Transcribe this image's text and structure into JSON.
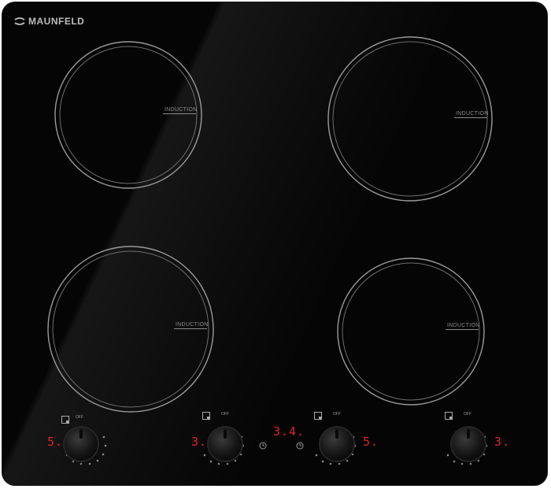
{
  "brand": {
    "name": "MAUNFELD"
  },
  "zones": [
    {
      "label": "INDUCTION"
    },
    {
      "label": "INDUCTION"
    },
    {
      "label": "INDUCTION"
    },
    {
      "label": "INDUCTION"
    }
  ],
  "controls": {
    "zone1_power": "5.",
    "zone2_power": "3.",
    "timer_display": "3.4.",
    "zone3_power": "5.",
    "zone4_power": "3.",
    "knob_off_label": "OFF"
  },
  "colors": {
    "glass": "#050505",
    "display": "#e0202a",
    "ring": "#9a9a9a"
  }
}
